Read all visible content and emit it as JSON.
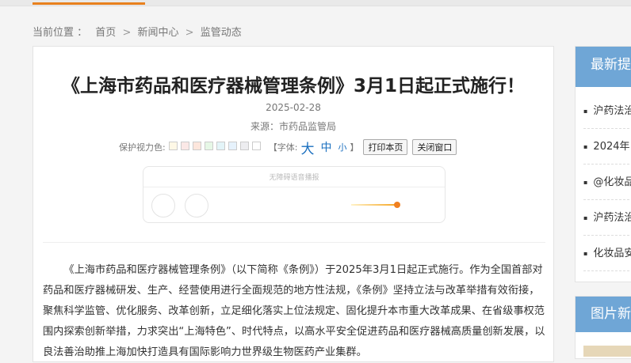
{
  "breadcrumb": {
    "prefix": "当前位置 ：",
    "items": [
      "首页",
      "新闻中心",
      "监管动态"
    ],
    "separator": ">"
  },
  "article": {
    "title": "《上海市药品和医疗器械管理条例》3月1日起正式施行！",
    "date": "2025-02-28",
    "source": "来源：市药品监管局",
    "tools": {
      "eye_care_label": "保护视力色:",
      "swatches": [
        "#fef8e6",
        "#fbe8e6",
        "#fde6dc",
        "#e6f7e6",
        "#e3f4f8",
        "#e6f2fc",
        "#ededf0",
        "#ffffff"
      ],
      "font_label": "【字体:",
      "font_big": "大",
      "font_mid": "中",
      "font_small": "小",
      "font_close": "】",
      "print_button": "打印本页",
      "close_button": "关闭窗口"
    },
    "player_label": "无障碍语音播报",
    "player_progress": 0.9,
    "body": "《上海市药品和医疗器械管理条例》（以下简称《条例》）于2025年3月1日起正式施行。作为全国首部对药品和医疗器械研发、生产、经营使用进行全面规范的地方性法规，《条例》坚持立法与改革举措有效衔接，聚焦科学监管、优化服务、改革创新，立足细化落实上位法规定、固化提升本市重大改革成果、在省级事权范围内探索创新举措，力求突出“上海特色”、时代特点，以高水平安全促进药品和医疗器械高质量创新发展，以良法善治助推上海加快打造具有国际影响力世界级生物医药产业集群。"
  },
  "sidebar": {
    "latest_title": "最新提",
    "latest_items": [
      "沪药法治",
      "2024年",
      "@化妆品",
      "沪药法治",
      "化妆品安"
    ],
    "pictures_title": "图片新"
  },
  "colors": {
    "accent_orange": "#e8801d",
    "sidebar_blue": "#6fa6d6",
    "link_blue": "#1a6fbf"
  }
}
